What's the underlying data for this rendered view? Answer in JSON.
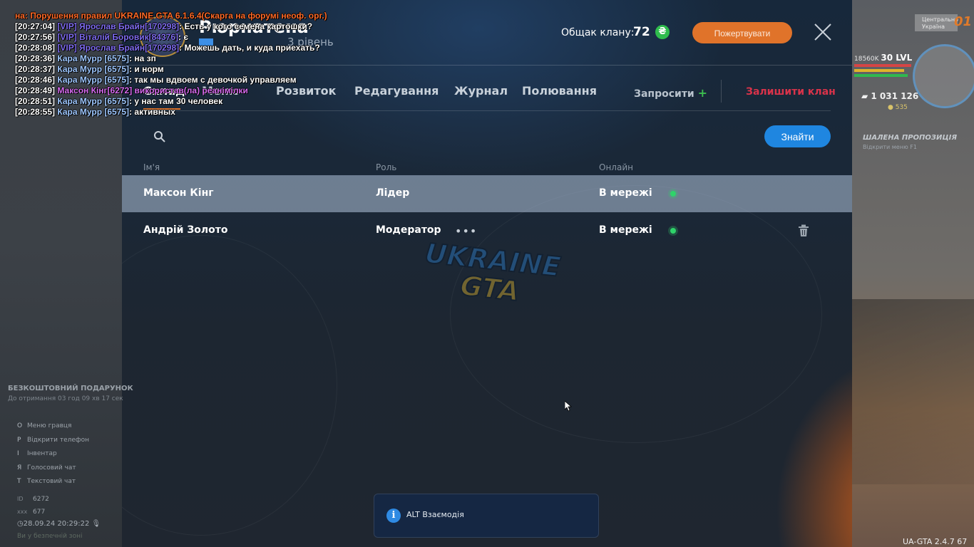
{
  "clan": {
    "title": "Рюрнатена",
    "level": "3 рівень",
    "treasury_label": "Общак клану:",
    "treasury_value": "72",
    "currency_icon": "₴",
    "donate_label": "Пожертвувати"
  },
  "tabs": [
    {
      "label": "Склад",
      "active": true
    },
    {
      "label": "Меню",
      "active": false
    },
    {
      "label": "Розвиток",
      "active": false
    },
    {
      "label": "Редагування",
      "active": false
    },
    {
      "label": "Журнал",
      "active": false
    },
    {
      "label": "Полювання",
      "active": false
    }
  ],
  "actions": {
    "invite_label": "Запросити",
    "invite_icon": "+",
    "leave_label": "Залишити клан"
  },
  "search": {
    "placeholder": "",
    "button_label": "Знайти"
  },
  "table": {
    "headers": [
      "Ім'я",
      "Роль",
      "Онлайн"
    ],
    "rows": [
      {
        "name": "Максон Кінг",
        "role": "Лідер",
        "status": "В мережі",
        "highlighted": true
      },
      {
        "name": "Андрій Золото",
        "role": "Модератор",
        "status": "В мережі",
        "highlighted": false
      }
    ]
  },
  "watermark": {
    "line1": "UKRAINE",
    "line2": "GTA"
  },
  "hint": {
    "icon": "i",
    "text": "ALT Взаємодія"
  },
  "chat": [
    {
      "parts": [
        {
          "c": "sys",
          "t": "на: Порушення правил UKRAINE GTA 6.1.6.4(Скарга на форумі неоф. орг.)"
        }
      ]
    },
    {
      "parts": [
        {
          "c": "ts",
          "t": "[20:27:04] "
        },
        {
          "c": "vip",
          "t": "[VIP] Ярослав Брайн[170298]"
        },
        {
          "c": "ts",
          "t": ": Есть у кого семена картошки?"
        }
      ]
    },
    {
      "parts": [
        {
          "c": "ts",
          "t": "[20:27:56] "
        },
        {
          "c": "vip",
          "t": "[VIP] Віталій Боровик[84376]"
        },
        {
          "c": "ts",
          "t": ": є"
        }
      ]
    },
    {
      "parts": [
        {
          "c": "ts",
          "t": "[20:28:08] "
        },
        {
          "c": "vip",
          "t": "[VIP] Ярослав Брайн[170298]"
        },
        {
          "c": "ts",
          "t": ": Можешь дать, и куда приехать?"
        }
      ]
    },
    {
      "parts": [
        {
          "c": "ts",
          "t": "[20:28:36] "
        },
        {
          "c": "pl",
          "t": "Кара Мурр [6575]"
        },
        {
          "c": "ts",
          "t": ": на зп"
        }
      ]
    },
    {
      "parts": [
        {
          "c": "ts",
          "t": "[20:28:37] "
        },
        {
          "c": "pl",
          "t": "Кара Мурр [6575]"
        },
        {
          "c": "ts",
          "t": ": и норм"
        }
      ]
    },
    {
      "parts": [
        {
          "c": "ts",
          "t": "[20:28:46] "
        },
        {
          "c": "pl",
          "t": "Кара Мурр [6575]"
        },
        {
          "c": "ts",
          "t": ": так мы вдвоем с девочкой управляем"
        }
      ]
    },
    {
      "parts": [
        {
          "c": "ts",
          "t": "[20:28:49] "
        },
        {
          "c": "pl2",
          "t": "Максон Кінг[6272] використав(ла) реанімілки"
        }
      ]
    },
    {
      "parts": [
        {
          "c": "ts",
          "t": "[20:28:51] "
        },
        {
          "c": "pl",
          "t": "Кара Мурр [6575]"
        },
        {
          "c": "ts",
          "t": ": у нас там 30 человек"
        }
      ]
    },
    {
      "parts": [
        {
          "c": "ts",
          "t": "[20:28:55] "
        },
        {
          "c": "pl",
          "t": "Кара Мурр [6575]"
        },
        {
          "c": "ts",
          "t": ": активных"
        }
      ]
    }
  ],
  "hud_left": {
    "gift_title": "БЕЗКОШТОВНИЙ ПОДАРУНОК",
    "gift_sub": "До отримання 03 год 09 хв 17 сек",
    "menu": [
      {
        "key": "O",
        "label": "Меню гравця"
      },
      {
        "key": "P",
        "label": "Відкрити телефон"
      },
      {
        "key": "I",
        "label": "Інвентар"
      },
      {
        "key": "Я",
        "label": "Голосовий чат"
      },
      {
        "key": "T",
        "label": "Текстовий чат"
      }
    ],
    "id_key": "ID",
    "id_value": "6272",
    "online_key": "ххх",
    "online_value": "677",
    "clock": "28.09.24 20:29:22",
    "safe_zone": "Ви у безпечній зоні"
  },
  "hud_right": {
    "region": "Центрально Україна",
    "region_number": "01",
    "exp": "18560K",
    "level": "30 LVL",
    "money": "1 031 126",
    "coins": "535",
    "promo_title": "ШАЛЕНА ПРОПОЗИЦІЯ",
    "promo_sub": "Відкрити меню",
    "promo_key": "F1"
  },
  "version": "UA-GTA 2.4.7   67",
  "colors": {
    "accent_orange": "#e0732a",
    "accent_blue": "#1f86e0",
    "online_green": "#2fd36a",
    "leave_red": "#d9334a"
  }
}
